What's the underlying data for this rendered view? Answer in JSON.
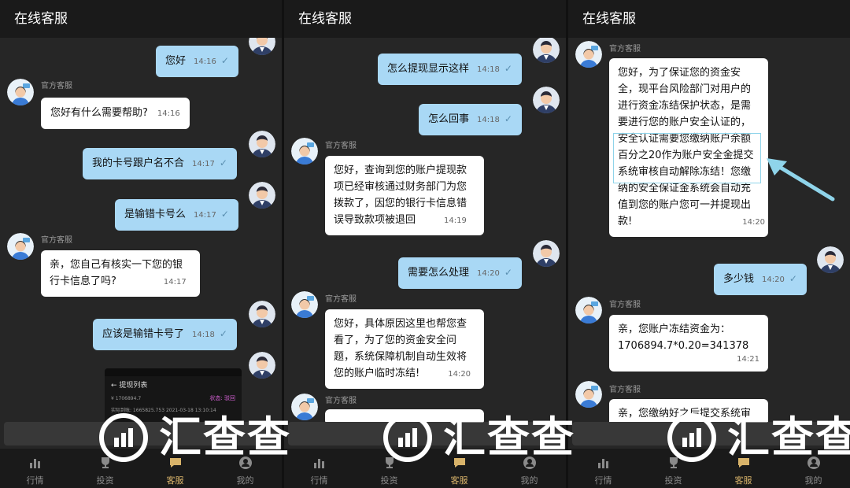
{
  "header_title": "在线客服",
  "agent_name": "官方客服",
  "tabs": [
    "行情",
    "投资",
    "客服",
    "我的"
  ],
  "active_tab": "客服",
  "watermark": "汇查查",
  "screen1": {
    "m1": {
      "text": "您好",
      "time": "14:16"
    },
    "m2": {
      "text": "您好有什么需要帮助?",
      "time": "14:16"
    },
    "m3": {
      "text": "我的卡号跟户名不合",
      "time": "14:17"
    },
    "m4": {
      "text": "是输错卡号么",
      "time": "14:17"
    },
    "m5": {
      "lines": [
        "亲，您自己有核实一下您的银",
        "行卡信息了吗?"
      ],
      "time": "14:17"
    },
    "m6": {
      "text": "应该是输错卡号了",
      "time": "14:18"
    },
    "mini_screenshot": {
      "title": "提现列表",
      "amount": "¥ 1706894.7",
      "status_label": "状态:",
      "status": "驳回",
      "detail": "实际到账: 1665825.753",
      "date": "2021-03-18 13:10:14"
    }
  },
  "screen2": {
    "m1": {
      "text": "怎么提现显示这样",
      "time": "14:18"
    },
    "m2": {
      "text": "怎么回事",
      "time": "14:18"
    },
    "m3": {
      "lines": [
        "您好，查询到您的账户提现款",
        "项已经审核通过财务部门为您",
        "拨款了，因您的银行卡信息错"
      ],
      "last": "误导致款项被退回",
      "time": "14:19"
    },
    "m4": {
      "text": "需要怎么处理",
      "time": "14:20"
    },
    "m5": {
      "lines": [
        "您好，具体原因这里也帮您查",
        "看了，为了您的资金安全问",
        "题，系统保障机制自动生效将"
      ],
      "last": "您的账户临时冻结!",
      "time": "14:20"
    }
  },
  "screen3": {
    "m1": {
      "lines": [
        "您好，为了保证您的资金安",
        "全，现平台风险部门对用户的",
        "进行资金冻结保护状态，是需",
        "要进行您的账户安全认证的，",
        "安全认证需要您缴纳账户余额",
        "百分之20作为账户安全金提交",
        "系统审核自动解除冻结！您缴",
        "纳的安全保证金系统会自动充",
        "值到您的账户您可一并提现出",
        "款!"
      ],
      "time": "14:20"
    },
    "m2": {
      "text": "多少钱",
      "time": "14:20"
    },
    "m3": {
      "lines": [
        "亲，您账户冻结资金为：",
        "1706894.7*0.20=341378"
      ],
      "time": "14:21"
    },
    "m4": {
      "text": "亲，您缴纳好之后提交系统审"
    }
  },
  "colors": {
    "user_bubble": "#a9d8f5",
    "agent_bubble": "#ffffff",
    "background": "#262626",
    "header": "#1a1a1a",
    "active_tab": "#d8b36a",
    "highlight": "#8fd4ea"
  },
  "icons": [
    "user-avatar-icon",
    "agent-avatar-icon",
    "read-tick-icon",
    "chart-icon",
    "trophy-icon",
    "chat-icon",
    "profile-icon"
  ]
}
